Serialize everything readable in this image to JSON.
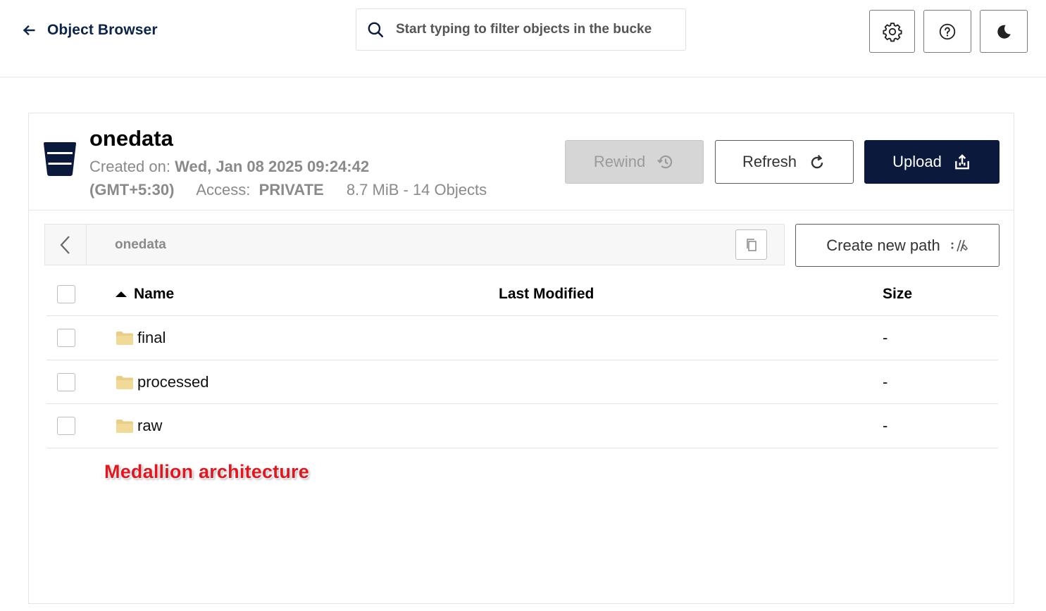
{
  "header": {
    "back_icon": "arrow-left-icon",
    "title": "Object Browser",
    "search": {
      "placeholder": "Start typing to filter objects in the bucke",
      "value": ""
    },
    "buttons": [
      {
        "name": "settings",
        "icon": "gear-icon"
      },
      {
        "name": "help",
        "icon": "help-circle-icon"
      },
      {
        "name": "theme",
        "icon": "moon-icon"
      }
    ]
  },
  "bucket": {
    "name": "onedata",
    "created_label": "Created on:",
    "created_value": "Wed, Jan 08 2025 09:24:42",
    "timezone": "(GMT+5:30)",
    "access_label": "Access:",
    "access_value": "PRIVATE",
    "usage": "8.7 MiB - 14 Objects",
    "actions": {
      "rewind": "Rewind",
      "refresh": "Refresh",
      "upload": "Upload"
    }
  },
  "breadcrumb": {
    "path": "onedata",
    "create_new_path": "Create new path"
  },
  "table": {
    "columns": [
      "Name",
      "Last Modified",
      "Size"
    ],
    "sort": {
      "column": "Name",
      "direction": "ascending"
    },
    "rows": [
      {
        "name": "final",
        "last_modified": "",
        "size": "-",
        "type": "folder"
      },
      {
        "name": "processed",
        "last_modified": "",
        "size": "-",
        "type": "folder"
      },
      {
        "name": "raw",
        "last_modified": "",
        "size": "-",
        "type": "folder"
      }
    ]
  },
  "annotation": "Medallion architecture",
  "colors": {
    "brand_navy": "#0b1a3c",
    "title_navy": "#0b2447",
    "folder": "#e9cf86",
    "annotation_red": "#e8141d"
  }
}
